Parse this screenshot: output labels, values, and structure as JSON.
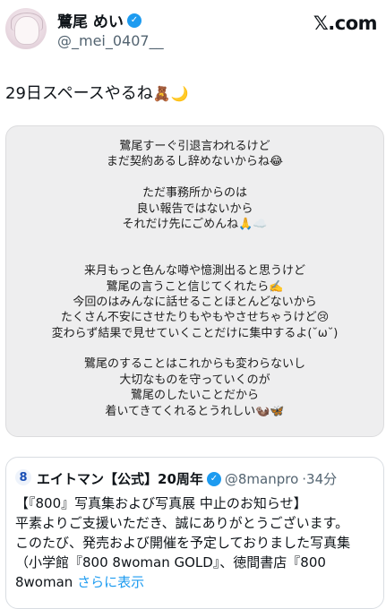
{
  "header": {
    "display_name": "鷺尾 めい",
    "handle": "@_mei_0407__",
    "brand": "𝕏.com",
    "verified_glyph": "✓"
  },
  "tweet": {
    "text": "29日スペースやるね",
    "emojis": "🧸🌙"
  },
  "image_text": [
    "鷺尾すーぐ引退言われるけど",
    "まだ契約あるし辞めないからね😂",
    "",
    "ただ事務所からのは",
    "良い報告ではないから",
    "それだけ先にごめんね🙏☁️",
    "",
    "",
    "来月もっと色んな噂や憶測出ると思うけど",
    "鷺尾の言うこと信じてくれたら✍️",
    "今回のはみんなに話せることほとんどないから",
    "たくさん不安にさせたりもやもやさせちゃうけど😢",
    "変わらず結果で見せていくことだけに集中するよ(˘ω˘)",
    "",
    "鷺尾のすることはこれからも変わらないし",
    "大切なものを守っていくのが",
    "鷺尾のしたいことだから",
    "着いてきてくれるとうれしい🦦🦋"
  ],
  "quote": {
    "avatar_text": "8",
    "name": "エイトマン【公式】20周年",
    "handle": "@8manpro",
    "time": "·34分",
    "lines": [
      "【『800』写真集および写真展 中止のお知らせ】",
      "平素よりご支援いただき、誠にありがとうございます。",
      "このたび、発売および開催を予定しておりました写真集",
      "（小学館『800 8woman GOLD』、徳間書店『800"
    ],
    "last_line_text": "8woman ",
    "show_more": "さらに表示"
  }
}
